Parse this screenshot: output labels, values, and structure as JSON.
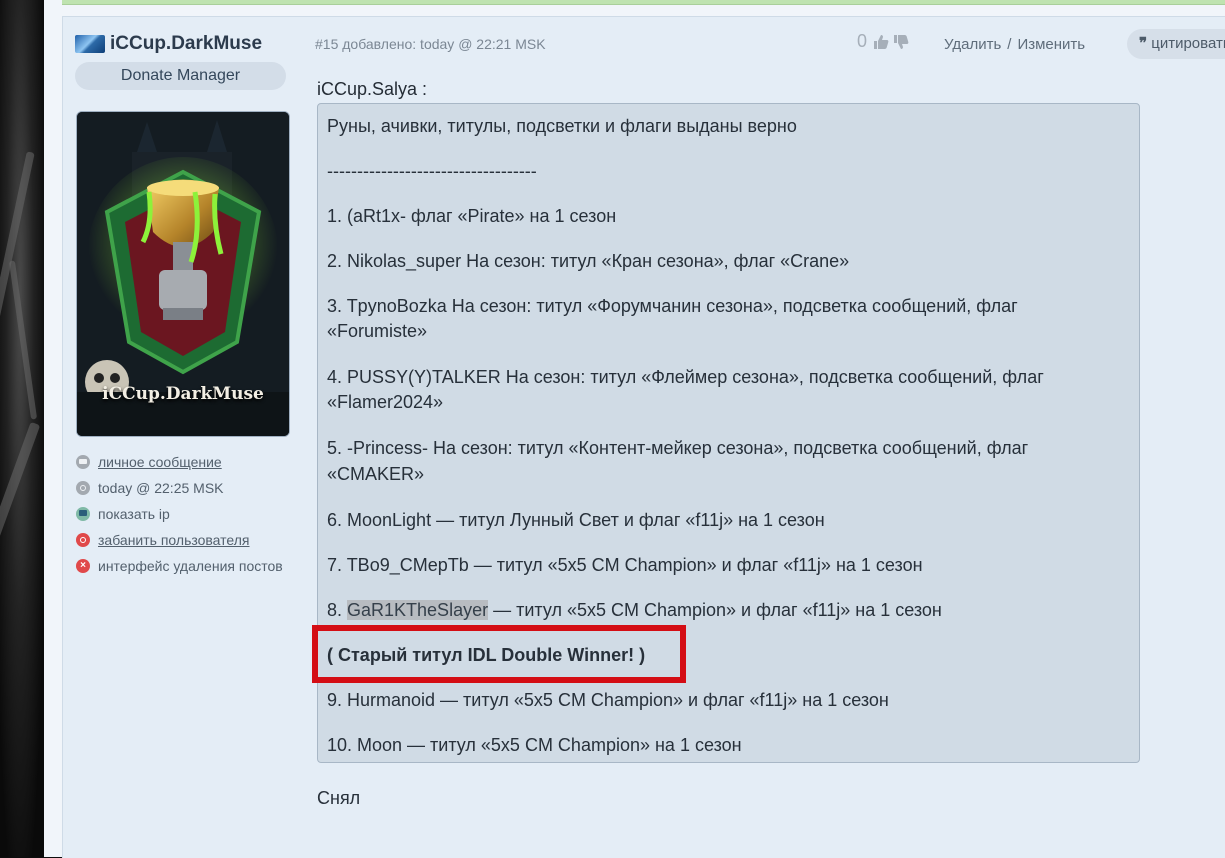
{
  "author": {
    "name": "iCCup.DarkMuse",
    "role": "Donate Manager",
    "avatar_caption": "iCCup.DarkMuse",
    "actions": [
      {
        "label": "личное сообщение",
        "icon": "message-icon",
        "link": true
      },
      {
        "label": "today @ 22:25 MSK",
        "icon": "clock-icon",
        "link": false
      },
      {
        "label": "показать ip",
        "icon": "monitor-icon",
        "link": false
      },
      {
        "label": "забанить пользователя",
        "icon": "ban-icon",
        "link": true
      },
      {
        "label": "интерфейс удаления постов",
        "icon": "delete-icon",
        "link": false
      }
    ]
  },
  "post": {
    "meta": "#15 добавлено: today @ 22:21 MSK",
    "vote_count": "0",
    "delete_label": "Удалить",
    "separator": "/",
    "edit_label": "Изменить",
    "quote_label": "цитировать",
    "quote_author": "iCCup.Salya :",
    "reply": "Снял"
  },
  "quote_lines": [
    "Руны, ачивки, титулы, подсветки и флаги выданы верно",
    "-----------------------------------",
    "1. (aRt1x- флаг «Pirate» на 1 сезон",
    "2. Nikolas_super На сезон: титул «Кран сезона», флаг «Crane»",
    "3. TpynoBozka На сезон: титул «Форумчанин сезона», подсветка сообщений, флаг",
    "«Forumiste»",
    "4. PUSSY(Y)TALKER На сезон: титул «Флеймер сезона», подсветка сообщений, флаг",
    "«Flamer2024»",
    "5. -Princess- На сезон: титул «Контент-мейкер сезона», подсветка сообщений, флаг",
    "«CMAKER»",
    "6. MoonLight — титул Лунный Свет и флаг «f11j» на 1 сезон",
    "7. TBo9_CMepTb — титул «5x5 CM Champion» и флаг «f11j» на 1 сезон",
    "8. ",
    "GaR1KTheSlayer",
    " — титул «5x5 CM Champion» и флаг «f11j» на 1 сезон",
    "( Старый титул IDL Double Winner! )",
    "9. Hurmanoid — титул «5x5 CM Champion» и флаг «f11j» на 1 сезон",
    "10. Moon — титул «5x5 CM Champion» на 1 сезон"
  ],
  "colors": {
    "highlight_frame": "#d40d14",
    "quote_bg": "#d0dbe5",
    "card_bg": "#e4edf6"
  }
}
